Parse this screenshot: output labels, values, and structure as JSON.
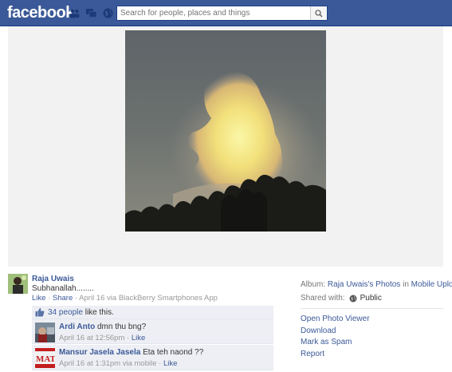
{
  "header": {
    "logo": "facebook",
    "search_placeholder": "Search for people, places and things"
  },
  "photo": {
    "alt": "glowing cloud over trees"
  },
  "post": {
    "author": "Raja Uwais",
    "caption": "Subhanallah........",
    "like": "Like",
    "share": "Share",
    "date": "April 16",
    "via_text": "via",
    "app": "BlackBerry Smartphones App"
  },
  "likes": {
    "count": "34 people",
    "suffix": "like this."
  },
  "comments": [
    {
      "name": "Ardi Anto",
      "text": "dmn thu bng?",
      "time": "April 16 at 12:56pm",
      "like": "Like"
    },
    {
      "name": "Mansur Jasela Jasela",
      "text": "Eta teh naond ??",
      "time": "April 16 at 1:31pm via mobile",
      "like": "Like"
    }
  ],
  "sidebar": {
    "album_label": "Album:",
    "album_link": "Raja Uwais's Photos",
    "album_in": "in",
    "album_sub": "Mobile Uploads",
    "shared_label": "Shared with:",
    "shared_value": "Public",
    "actions": [
      "Open Photo Viewer",
      "Download",
      "Mark as Spam",
      "Report"
    ]
  },
  "colors": {
    "brand": "#3b5998",
    "link": "#3b5998",
    "comment_bg": "#edeff4"
  }
}
